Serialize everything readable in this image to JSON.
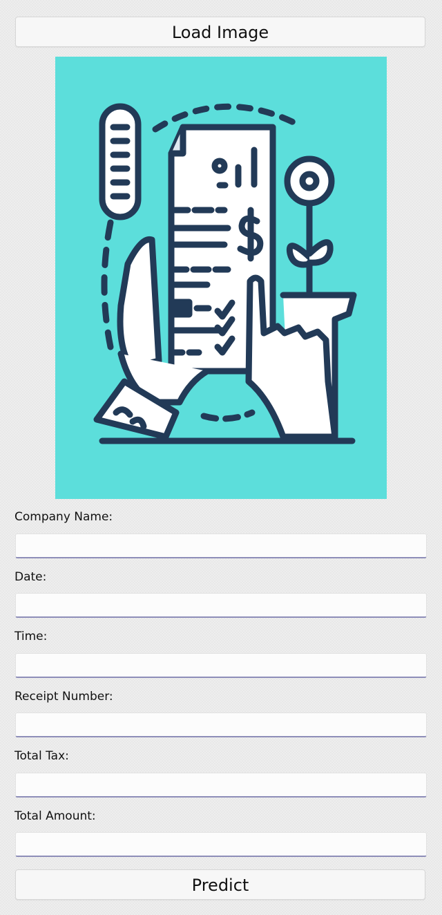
{
  "buttons": {
    "load_label": "Load Image",
    "predict_label": "Predict"
  },
  "preview": {
    "icon": "receipt-hand-illustration-icon",
    "background_color": "#5cdedb",
    "line_color": "#223a57"
  },
  "fields": [
    {
      "label": "Company Name:",
      "value": ""
    },
    {
      "label": "Date:",
      "value": ""
    },
    {
      "label": "Time:",
      "value": ""
    },
    {
      "label": "Receipt Number:",
      "value": ""
    },
    {
      "label": "Total Tax:",
      "value": ""
    },
    {
      "label": "Total Amount:",
      "value": ""
    }
  ]
}
